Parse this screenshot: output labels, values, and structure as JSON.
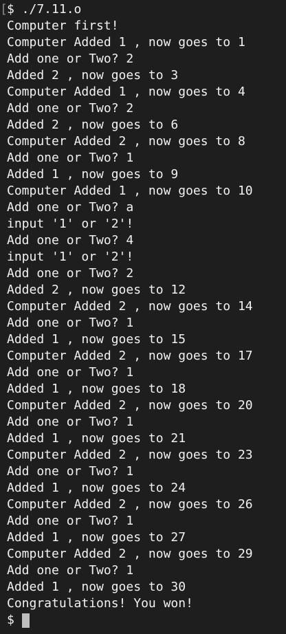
{
  "terminal": {
    "lines": [
      "$ ./7.11.o",
      "Computer first!",
      "Computer Added 1 , now goes to 1",
      "Add one or Two? 2",
      "Added 2 , now goes to 3",
      "Computer Added 1 , now goes to 4",
      "Add one or Two? 2",
      "Added 2 , now goes to 6",
      "Computer Added 2 , now goes to 8",
      "Add one or Two? 1",
      "Added 1 , now goes to 9",
      "Computer Added 1 , now goes to 10",
      "Add one or Two? a",
      "input '1' or '2'!",
      "Add one or Two? 4",
      "input '1' or '2'!",
      "Add one or Two? 2",
      "Added 2 , now goes to 12",
      "Computer Added 2 , now goes to 14",
      "Add one or Two? 1",
      "Added 1 , now goes to 15",
      "Computer Added 2 , now goes to 17",
      "Add one or Two? 1",
      "Added 1 , now goes to 18",
      "Computer Added 2 , now goes to 20",
      "Add one or Two? 1",
      "Added 1 , now goes to 21",
      "Computer Added 2 , now goes to 23",
      "Add one or Two? 1",
      "Added 1 , now goes to 24",
      "Computer Added 2 , now goes to 26",
      "Add one or Two? 1",
      "Added 1 , now goes to 27",
      "Computer Added 2 , now goes to 29",
      "Add one or Two? 1",
      "Added 1 , now goes to 30",
      "Congratulations! You won!"
    ],
    "prompt": "$ ",
    "left_marker": "[",
    "colors": {
      "background": "#1e1e1e",
      "text": "#f2f2f2",
      "cursor": "#bfbfbf"
    }
  }
}
